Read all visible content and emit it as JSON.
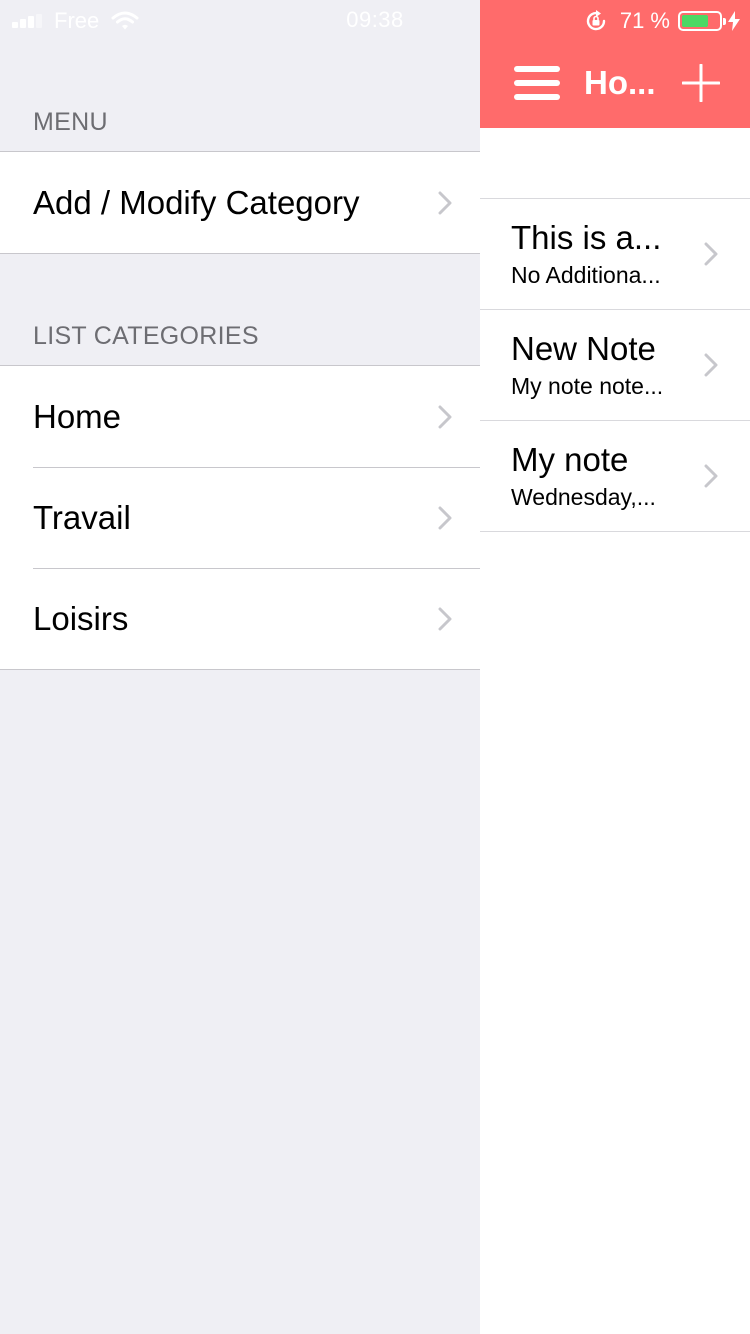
{
  "status_bar": {
    "carrier": "Free",
    "time": "09:38",
    "battery_percent": "71 %",
    "battery_level": 0.71,
    "icons": [
      "signal-icon",
      "wifi-icon",
      "rotation-lock-icon",
      "battery-icon",
      "charging-bolt-icon"
    ]
  },
  "menu": {
    "section_menu": "MENU",
    "menu_items": [
      {
        "label": "Add / Modify Category",
        "icon": "chevron-right-icon"
      }
    ],
    "section_categories": "LIST CATEGORIES",
    "categories": [
      {
        "label": "Home",
        "icon": "chevron-right-icon"
      },
      {
        "label": "Travail",
        "icon": "chevron-right-icon"
      },
      {
        "label": "Loisirs",
        "icon": "chevron-right-icon"
      }
    ]
  },
  "notes_panel": {
    "nav_title": "Ho...",
    "nav_left_icon": "hamburger-menu-icon",
    "nav_right_icon": "plus-icon",
    "notes": [
      {
        "title": "This is a...",
        "subtitle": "No Additiona..."
      },
      {
        "title": "New Note",
        "subtitle": "My note note..."
      },
      {
        "title": "My note",
        "subtitle": "Wednesday,..."
      }
    ]
  },
  "colors": {
    "accent": "#ff6b6b",
    "menu_background": "#efeff4",
    "section_text": "#6d6d72",
    "separator": "#c8c7cc",
    "chevron": "#c7c7cc",
    "battery_fill": "#4cd964"
  }
}
